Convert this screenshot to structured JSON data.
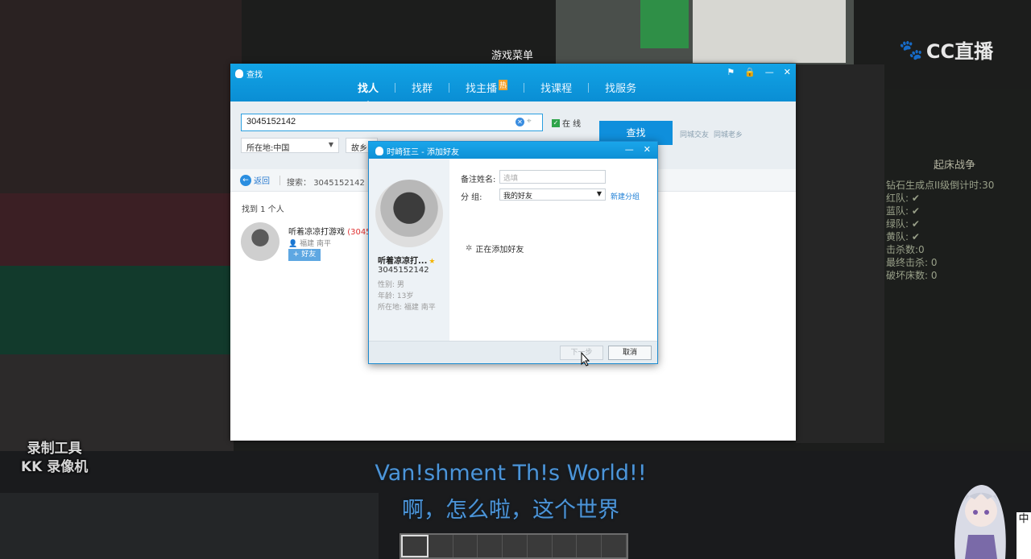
{
  "game": {
    "menu_title": "游戏菜单",
    "watermark_line1": "录制工具",
    "watermark_line2": "KK 录像机",
    "subtitle_en": "Van!shment Th!s World!!",
    "subtitle_cn": "啊，怎么啦，这个世界",
    "cc_logo": "CC直播",
    "hud_title": "起床战争",
    "hud_lines": [
      "钻石生成点II级倒计时:30",
      "红队: ✔",
      "蓝队: ✔",
      "绿队: ✔",
      "黄队: ✔",
      "击杀数:0",
      "最终击杀: 0",
      "破坏床数: 0"
    ],
    "side_text": "中"
  },
  "find_window": {
    "title": "查找",
    "controls": [
      "⚑",
      "🔒",
      "—",
      "✕"
    ],
    "tabs": [
      {
        "label": "找人",
        "active": true
      },
      {
        "label": "找群",
        "active": false
      },
      {
        "label": "找主播",
        "active": false,
        "badge": "热"
      },
      {
        "label": "找课程",
        "active": false
      },
      {
        "label": "找服务",
        "active": false
      }
    ],
    "search_value": "3045152142",
    "online_label": "在 线",
    "online_checked": true,
    "find_button": "查找",
    "side_link1": "同城交友",
    "side_link2": "同城老乡",
    "location_select": "所在地:中国",
    "home_select": "故乡:",
    "back_label": "返回",
    "search_label_prefix": "搜索：",
    "search_label_value": "3045152142",
    "found_count": "找到 1 个人",
    "result": {
      "name": "听着凉凉打游戏",
      "qq_partial": "(30451",
      "location": "福建  南平",
      "add_button": "+ 好友"
    }
  },
  "add_dialog": {
    "title": "时崎狂三 - 添加好友",
    "controls": [
      "—",
      "✕"
    ],
    "nickname": "听着凉凉打...",
    "qq": "3045152142",
    "gender": "性别: 男",
    "age": "年龄: 13岁",
    "location": "所在地: 福建  南平",
    "remark_label": "备注姓名:",
    "remark_placeholder": "选填",
    "group_label": "分    组:",
    "group_value": "我的好友",
    "new_group": "新建分组",
    "adding_status": "正在添加好友",
    "next_button": "下一步",
    "cancel_button": "取消"
  }
}
